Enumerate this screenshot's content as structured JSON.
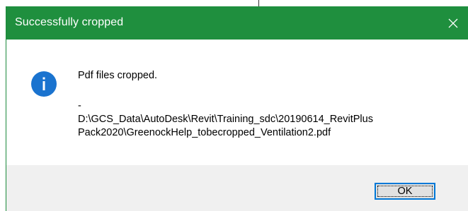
{
  "dialog": {
    "title": "Successfully cropped",
    "close_icon": "close-icon",
    "icon": "info-icon",
    "message_lines": [
      "Pdf files cropped.",
      "-",
      "D:\\GCS_Data\\AutoDesk\\Revit\\Training_sdc\\20190614_RevitPlus",
      "Pack2020\\GreenockHelp_tobecropped_Ventilation2.pdf"
    ],
    "ok_label": "OK"
  },
  "colors": {
    "titlebar": "#1f8f3e",
    "title_text": "#ffffff",
    "info_icon": "#1a73cf",
    "footer": "#f0f0f0",
    "ok_border": "#0078d7"
  }
}
